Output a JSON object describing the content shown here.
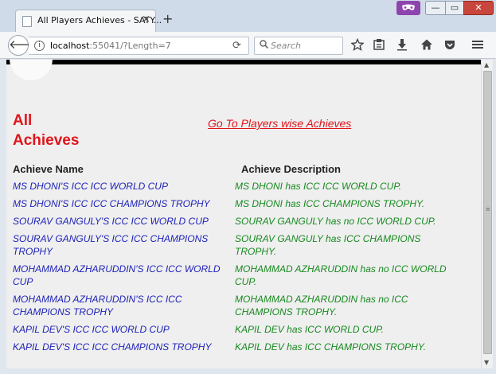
{
  "browser": {
    "tab_title": "All Players Achieves - SATY...",
    "tab_close": "×",
    "new_tab": "+",
    "url_host": "localhost",
    "url_rest": ":55041/?Length=7",
    "search_placeholder": "Search",
    "back_glyph": "🡐",
    "reload_glyph": "⟳",
    "win_min": "—",
    "win_max": "▭",
    "win_close": "✕",
    "icons": [
      "private-browsing-icon",
      "info-icon",
      "reload-icon",
      "search-icon",
      "bookmark-star-icon",
      "reading-list-icon",
      "download-icon",
      "home-icon",
      "pocket-icon",
      "menu-icon"
    ]
  },
  "page": {
    "title": "All Achieves",
    "goto_link": "Go To Players wise Achieves",
    "table": {
      "headers": [
        "Achieve Name",
        "Achieve Description"
      ],
      "rows": [
        [
          "MS DHONI'S ICC ICC WORLD CUP",
          "MS DHONI has ICC ICC WORLD CUP."
        ],
        [
          "MS DHONI'S ICC ICC CHAMPIONS TROPHY",
          "MS DHONI has ICC CHAMPIONS TROPHY."
        ],
        [
          "SOURAV GANGULY'S ICC ICC WORLD CUP",
          "SOURAV GANGULY has no ICC WORLD CUP."
        ],
        [
          "SOURAV GANGULY'S ICC ICC CHAMPIONS TROPHY",
          "SOURAV GANGULY has ICC CHAMPIONS TROPHY."
        ],
        [
          "MOHAMMAD AZHARUDDIN'S ICC ICC WORLD CUP",
          "MOHAMMAD AZHARUDDIN has no ICC WORLD CUP."
        ],
        [
          "MOHAMMAD AZHARUDDIN'S ICC ICC CHAMPIONS TROPHY",
          "MOHAMMAD AZHARUDDIN has no ICC CHAMPIONS TROPHY."
        ],
        [
          "KAPIL DEV'S ICC ICC WORLD CUP",
          "KAPIL DEV has ICC WORLD CUP."
        ],
        [
          "KAPIL DEV'S ICC ICC CHAMPIONS TROPHY",
          "KAPIL DEV has ICC CHAMPIONS TROPHY."
        ]
      ]
    }
  },
  "colors": {
    "title_red": "#e0151c",
    "name_blue": "#1b1fb8",
    "desc_green": "#17891f",
    "private_purple": "#8e44ad"
  }
}
